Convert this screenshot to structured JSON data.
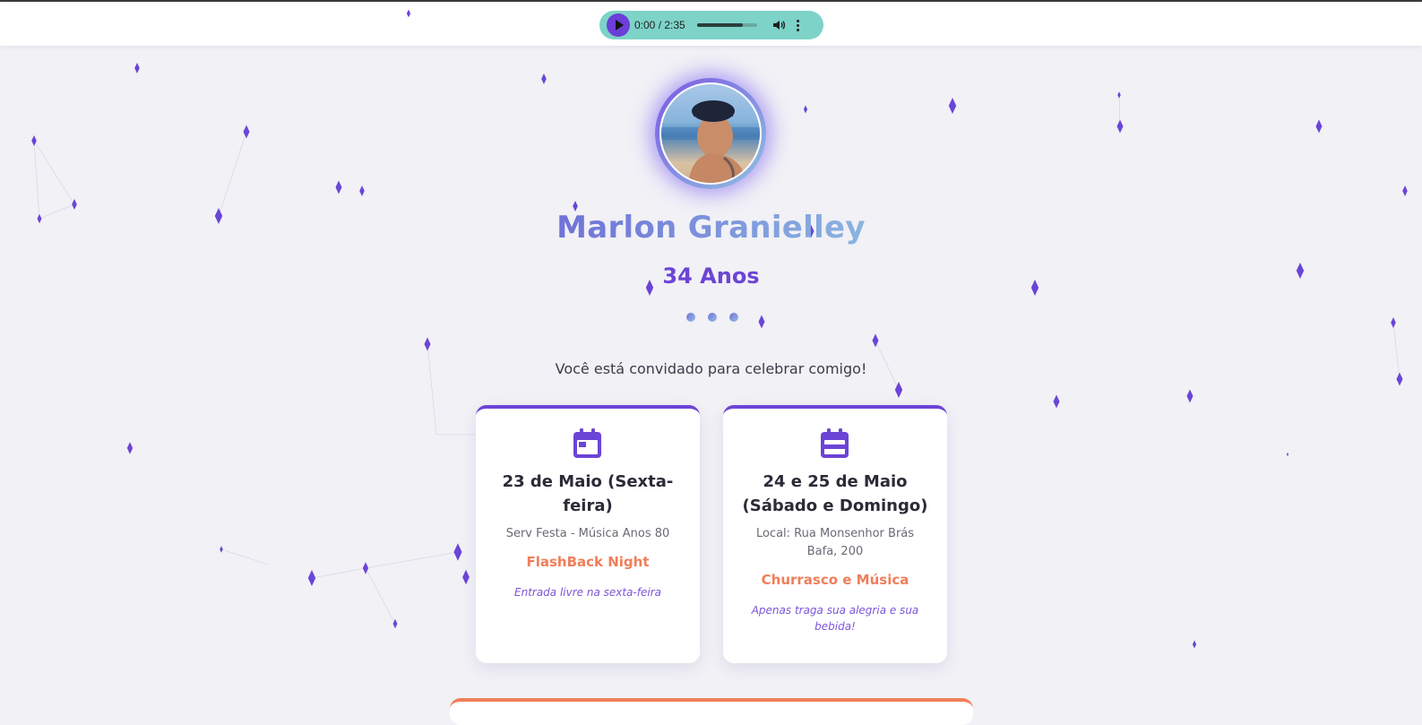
{
  "audio_player": {
    "time": "0:00 / 2:35",
    "progress_fraction": 0.76
  },
  "profile": {
    "name": "Marlon Granielley",
    "age": "34 Anos"
  },
  "invite_text": "Você está convidado para celebrar comigo!",
  "cards": [
    {
      "title": "23 de Maio (Sexta-feira)",
      "place": "Serv Festa - Música Anos 80",
      "event": "FlashBack Night",
      "note": "Entrada livre na sexta-feira"
    },
    {
      "title": "24 e 25 de Maio (Sábado e Domingo)",
      "place": "Local: Rua Monsenhor Brás Bafa, 200",
      "event": "Churrasco e Música",
      "note": "Apenas traga sua alegria e sua bebida!"
    }
  ],
  "colors": {
    "accent_purple": "#6b45d6",
    "accent_orange": "#f07e5a",
    "player_bg": "#7dd3c8",
    "page_bg": "#f1f1f6"
  }
}
